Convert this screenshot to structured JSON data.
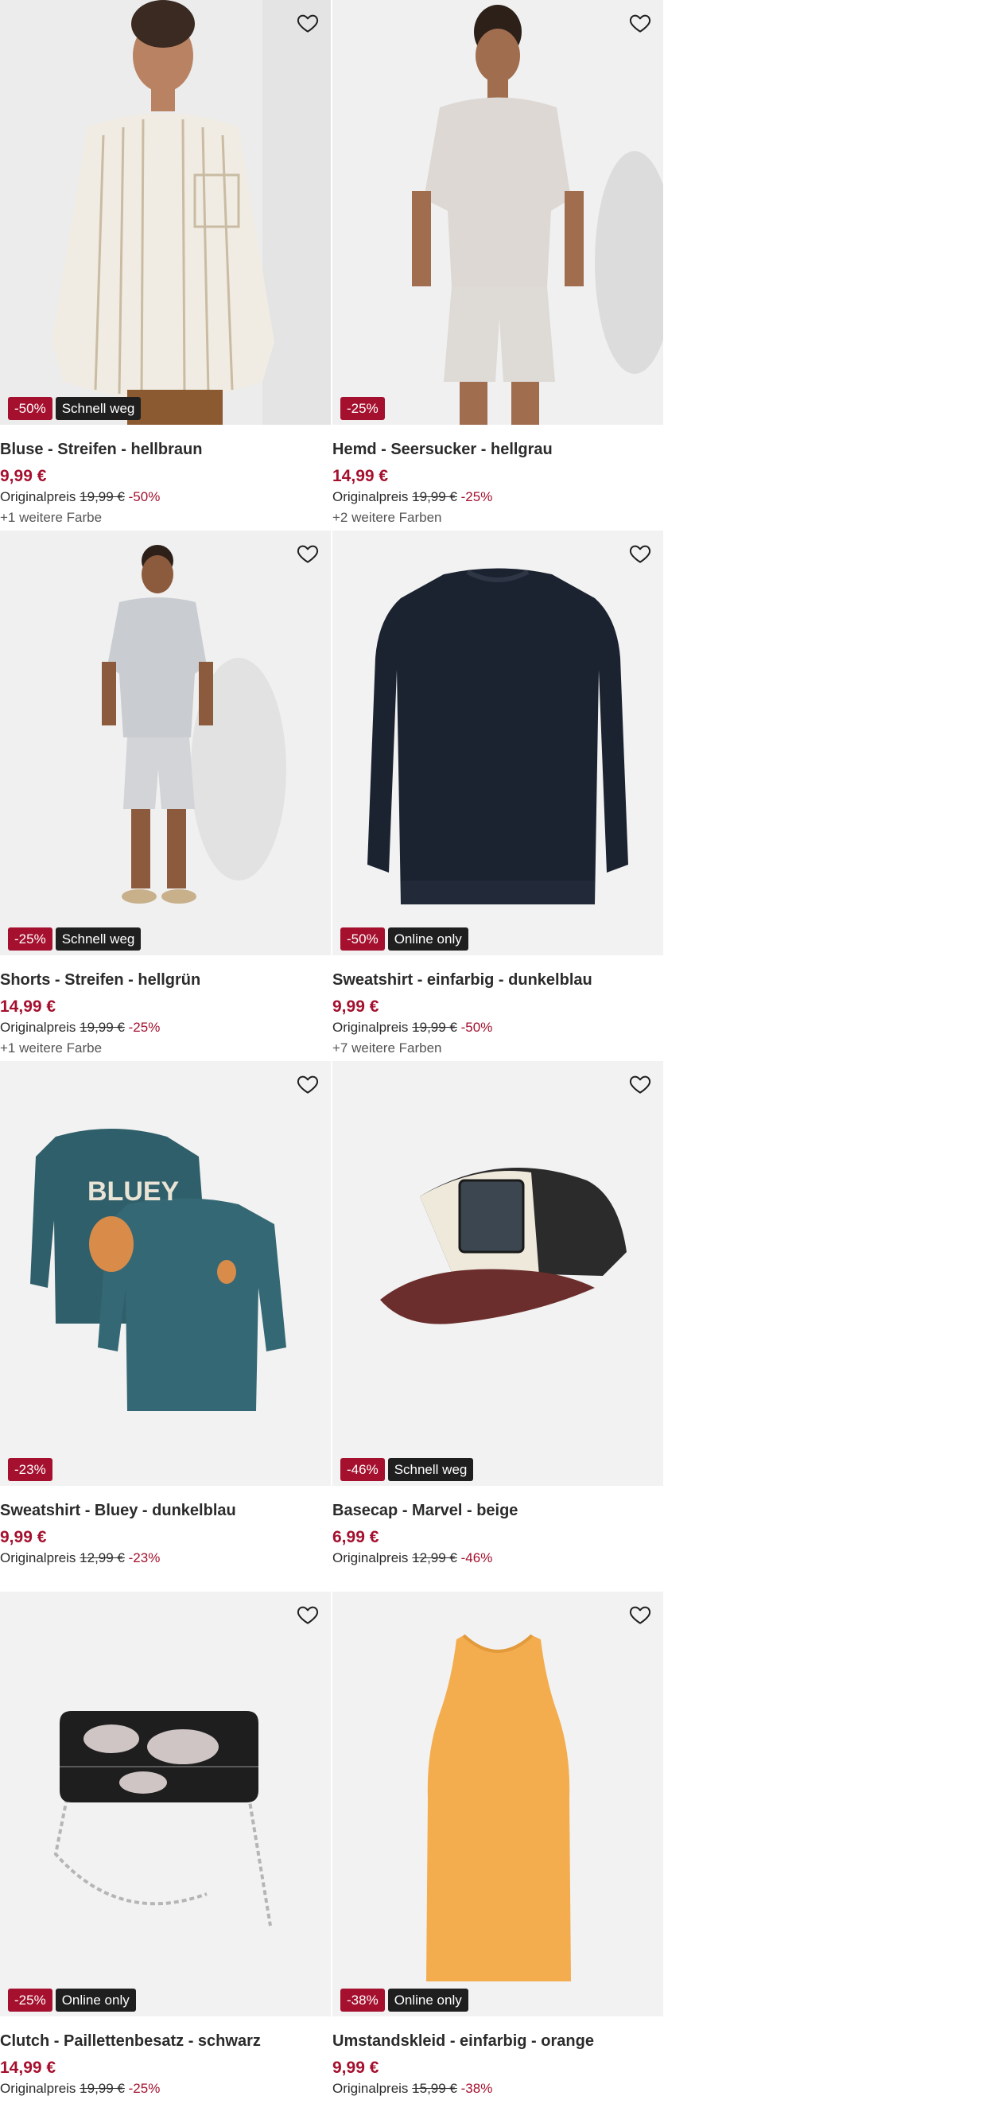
{
  "products": [
    {
      "title": "Bluse - Streifen - hellbraun",
      "price": "9,99 €",
      "original_label": "Originalpreis",
      "original_price": "19,99 €",
      "discount": "-50%",
      "badge_discount": "-50%",
      "badge_flag": "Schnell weg",
      "more_colors": "+1 weitere Farbe",
      "image": "woman-striped-blouse"
    },
    {
      "title": "Hemd - Seersucker - hellgrau",
      "price": "14,99 €",
      "original_label": "Originalpreis",
      "original_price": "19,99 €",
      "discount": "-25%",
      "badge_discount": "-25%",
      "badge_flag": "",
      "more_colors": "+2 weitere Farben",
      "image": "man-light-grey-shirt"
    },
    {
      "title": "Shorts - Streifen - hellgrün",
      "price": "14,99 €",
      "original_label": "Originalpreis",
      "original_price": "19,99 €",
      "discount": "-25%",
      "badge_discount": "-25%",
      "badge_flag": "Schnell weg",
      "more_colors": "+1 weitere Farbe",
      "image": "man-shirt-shorts-fullbody"
    },
    {
      "title": "Sweatshirt - einfarbig - dunkelblau",
      "price": "9,99 €",
      "original_label": "Originalpreis",
      "original_price": "19,99 €",
      "discount": "-50%",
      "badge_discount": "-50%",
      "badge_flag": "Online only",
      "more_colors": "+7 weitere Farben",
      "image": "navy-sweatshirt"
    },
    {
      "title": "Sweatshirt - Bluey - dunkelblau",
      "price": "9,99 €",
      "original_label": "Originalpreis",
      "original_price": "12,99 €",
      "discount": "-23%",
      "badge_discount": "-23%",
      "badge_flag": "",
      "more_colors": "",
      "image": "bluey-sweatshirts"
    },
    {
      "title": "Basecap - Marvel - beige",
      "price": "6,99 €",
      "original_label": "Originalpreis",
      "original_price": "12,99 €",
      "discount": "-46%",
      "badge_discount": "-46%",
      "badge_flag": "Schnell weg",
      "more_colors": "",
      "image": "trucker-cap"
    },
    {
      "title": "Clutch - Paillettenbesatz - schwarz",
      "price": "14,99 €",
      "original_label": "Originalpreis",
      "original_price": "19,99 €",
      "discount": "-25%",
      "badge_discount": "-25%",
      "badge_flag": "Online only",
      "more_colors": "",
      "image": "sequin-clutch"
    },
    {
      "title": "Umstandskleid - einfarbig - orange",
      "price": "9,99 €",
      "original_label": "Originalpreis",
      "original_price": "15,99 €",
      "discount": "-38%",
      "badge_discount": "-38%",
      "badge_flag": "Online only",
      "more_colors": "",
      "image": "orange-dress"
    }
  ],
  "icons": {
    "favorite": "heart-outline-icon"
  },
  "colors": {
    "sale": "#a4102e",
    "flag": "#1f1f1f",
    "image_bg": "#f2f2f2"
  }
}
